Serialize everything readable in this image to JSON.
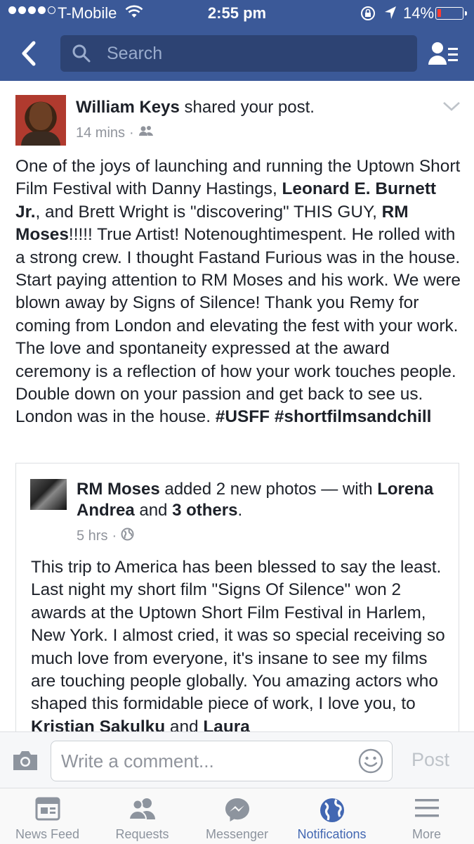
{
  "status_bar": {
    "carrier": "T-Mobile",
    "time": "2:55 pm",
    "battery_percent": "14%",
    "battery_level": 0.14,
    "signal_bars_filled": 4,
    "signal_bars_total": 5
  },
  "nav": {
    "search_placeholder": "Search"
  },
  "post": {
    "author": "William Keys",
    "action": "shared your post.",
    "time": "14 mins",
    "audience_icon": "friends-icon",
    "body_segments": [
      {
        "t": "One of the joys of launching and running the Uptown Short Film Festival with Danny Hastings, ",
        "b": false
      },
      {
        "t": "Leonard E. Burnett Jr.",
        "b": true
      },
      {
        "t": ", and Brett Wright is \"discovering\" THIS GUY, ",
        "b": false
      },
      {
        "t": "RM Moses",
        "b": true
      },
      {
        "t": "!!!!! True Artist! Notenoughtimespent. He rolled with a strong crew. I thought Fastand Furious was in the house. Start paying attention to RM Moses and his work. We were blown away by Signs of Silence! Thank you Remy for coming from London and elevating the fest with your work. The love and spontaneity expressed at the award ceremony is a reflection of how your work touches people. Double down on your passion and get back to see us. London was in the house. ",
        "b": false
      },
      {
        "t": "#USFF",
        "b": true
      },
      {
        "t": "  ",
        "b": false
      },
      {
        "t": "#shortfilmsandchill",
        "b": true
      }
    ]
  },
  "shared": {
    "author": "RM Moses",
    "action": " added 2 new photos — with ",
    "tagged": "Lorena Andrea",
    "and_text": " and ",
    "others": "3 others",
    "period": ".",
    "time": "5 hrs",
    "audience_icon": "globe-icon",
    "body_segments": [
      {
        "t": "This trip to America has been blessed to say the least. Last night my short film \"Signs Of Silence\" won 2 awards at the Uptown Short Film Festival in Harlem, New York. I almost cried, it was so special receiving so much love from everyone, it's insane to see my films are touching people globally. You amazing actors who shaped this formidable piece of work, I love you, to ",
        "b": false
      },
      {
        "t": "Kristian Sakulku",
        "b": true
      },
      {
        "t": " and ",
        "b": false
      },
      {
        "t": "Laura",
        "b": true
      }
    ]
  },
  "comment_bar": {
    "placeholder": "Write a comment...",
    "post_label": "Post"
  },
  "tabs": [
    {
      "label": "News Feed",
      "icon": "news-feed-icon",
      "active": false
    },
    {
      "label": "Requests",
      "icon": "requests-icon",
      "active": false
    },
    {
      "label": "Messenger",
      "icon": "messenger-icon",
      "active": false
    },
    {
      "label": "Notifications",
      "icon": "notifications-globe-icon",
      "active": true
    },
    {
      "label": "More",
      "icon": "menu-icon",
      "active": false
    }
  ],
  "colors": {
    "brand": "#3b5998",
    "active_tab": "#4267b2",
    "battery_low": "#ff3b30"
  }
}
